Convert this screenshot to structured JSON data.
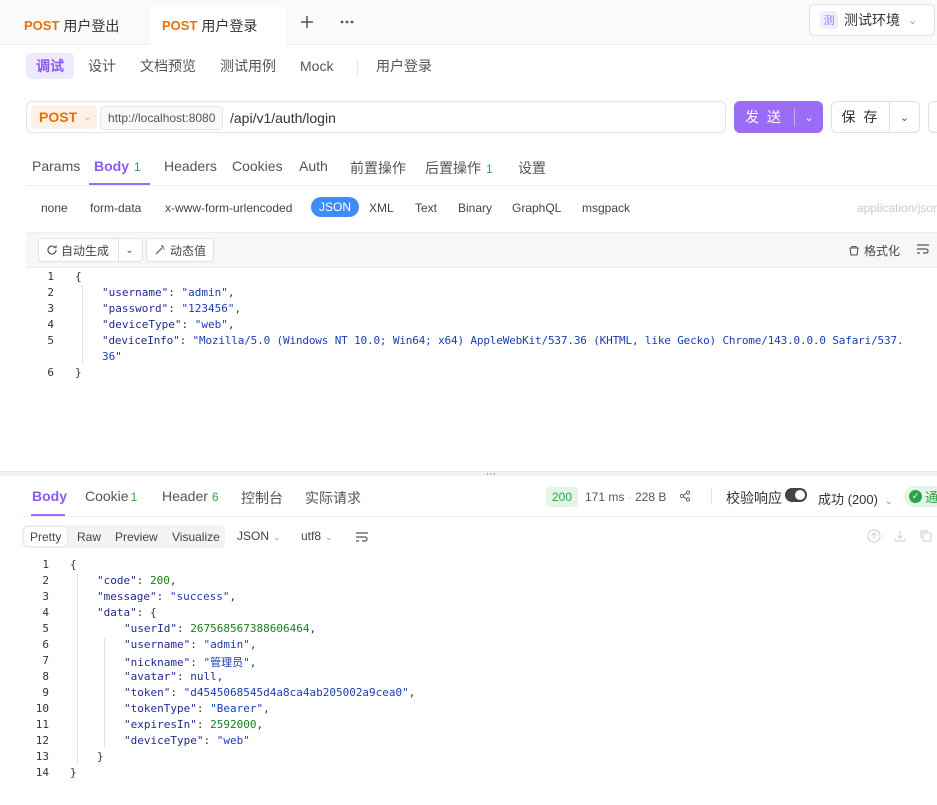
{
  "tabs": [
    {
      "method": "POST",
      "title": "用户登出"
    },
    {
      "method": "POST",
      "title": "用户登录"
    }
  ],
  "env": {
    "badge": "测",
    "label": "测试环境"
  },
  "mode_tabs": [
    "调试",
    "设计",
    "文档预览",
    "测试用例",
    "Mock"
  ],
  "endpoint_name": "用户登录",
  "request": {
    "method": "POST",
    "base_url": "http://localhost:8080",
    "path": "/api/v1/auth/login",
    "send_label": "发 送",
    "save_label": "保 存"
  },
  "request_tabs": [
    {
      "label": "Params",
      "count": ""
    },
    {
      "label": "Body",
      "count": "1"
    },
    {
      "label": "Headers",
      "count": ""
    },
    {
      "label": "Cookies",
      "count": ""
    },
    {
      "label": "Auth",
      "count": ""
    },
    {
      "label": "前置操作",
      "count": ""
    },
    {
      "label": "后置操作",
      "count": "1"
    },
    {
      "label": "设置",
      "count": ""
    }
  ],
  "body_types": [
    "none",
    "form-data",
    "x-www-form-urlencoded",
    "JSON",
    "XML",
    "Text",
    "Binary",
    "GraphQL",
    "msgpack"
  ],
  "content_type_hint": "application/json",
  "editor_toolbar": {
    "auto_gen": "自动生成",
    "dynamic": "动态值",
    "format": "格式化"
  },
  "request_body_lines": [
    {
      "n": "1",
      "text": "{"
    },
    {
      "n": "2",
      "key": "username",
      "val": "admin"
    },
    {
      "n": "3",
      "key": "password",
      "val": "123456"
    },
    {
      "n": "4",
      "key": "deviceType",
      "val": "web"
    },
    {
      "n": "5",
      "key": "deviceInfo",
      "val": "Mozilla/5.0 (Windows NT 10.0; Win64; x64) AppleWebKit/537.36 (KHTML, like Gecko) Chrome/143.0.0.0 Safari/537.",
      "wrap": "36\""
    },
    {
      "n": "6",
      "text": "}"
    }
  ],
  "response": {
    "tabs": [
      {
        "label": "Body",
        "count": ""
      },
      {
        "label": "Cookie",
        "count": "1"
      },
      {
        "label": "Header",
        "count": "6"
      },
      {
        "label": "控制台",
        "count": ""
      },
      {
        "label": "实际请求",
        "count": ""
      }
    ],
    "status_code": "200",
    "time": "171 ms",
    "size": "228 B",
    "validate_label": "校验响应",
    "result_label": "成功 (200)",
    "pass_label": "通",
    "views": [
      "Pretty",
      "Raw",
      "Preview",
      "Visualize"
    ],
    "format": "JSON",
    "encoding": "utf8"
  },
  "response_body_lines": [
    {
      "n": "1",
      "ind": 0,
      "text": "{"
    },
    {
      "n": "2",
      "ind": 1,
      "key": "code",
      "num": "200"
    },
    {
      "n": "3",
      "ind": 1,
      "key": "message",
      "val": "success"
    },
    {
      "n": "4",
      "ind": 1,
      "key": "data",
      "open": "{"
    },
    {
      "n": "5",
      "ind": 2,
      "key": "userId",
      "num": "267568567388606464"
    },
    {
      "n": "6",
      "ind": 2,
      "key": "username",
      "val": "admin"
    },
    {
      "n": "7",
      "ind": 2,
      "key": "nickname",
      "val": "管理员"
    },
    {
      "n": "8",
      "ind": 2,
      "key": "avatar",
      "num": "null"
    },
    {
      "n": "9",
      "ind": 2,
      "key": "token",
      "val": "d4545068545d4a8ca4ab205002a9cea0"
    },
    {
      "n": "10",
      "ind": 2,
      "key": "tokenType",
      "val": "Bearer"
    },
    {
      "n": "11",
      "ind": 2,
      "key": "expiresIn",
      "num": "2592000"
    },
    {
      "n": "12",
      "ind": 2,
      "key": "deviceType",
      "val": "web",
      "last": true
    },
    {
      "n": "13",
      "ind": 1,
      "text": "}"
    },
    {
      "n": "14",
      "ind": 0,
      "text": "}"
    }
  ],
  "colors": {
    "accent": "#9b6cf6",
    "method": "#e8700a",
    "success": "#2fa34a",
    "json_tab": "#3f8cf7"
  }
}
